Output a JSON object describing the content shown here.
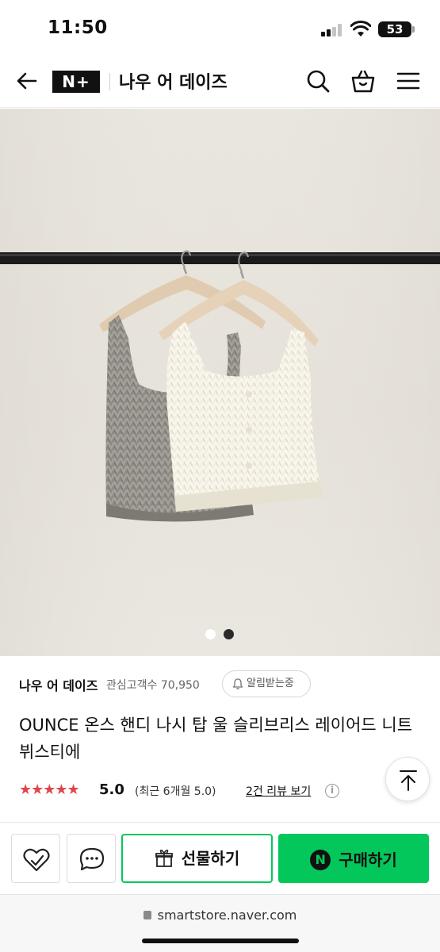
{
  "status_bar": {
    "time": "11:50",
    "battery": "53"
  },
  "header": {
    "brand_logo": "N+",
    "store_name": "나우 어 데이즈",
    "icons": [
      "back-arrow-icon",
      "search-icon",
      "shopping-bag-icon",
      "menu-icon"
    ]
  },
  "gallery": {
    "image_description_icon": "product-photo",
    "page_count": 2,
    "active_page": 2,
    "colors": {
      "background": "#e8e5de",
      "rod": "#1b1b1b",
      "gray_knit": "#8f8c86",
      "cream_knit": "#f3efe3",
      "hanger": "#e2cdb2"
    }
  },
  "store_info": {
    "name": "나우 어 데이즈",
    "favorites_label": "관심고객수 70,950",
    "alert_button": "알림받는중"
  },
  "product": {
    "title": "OUNCE 온스 핸디 나시 탑 울 슬리브리스 레이어드 니트 뷔스티에",
    "stars": "★★★★★",
    "rating": "5.0",
    "recent_rating": "(최근 6개월 5.0)",
    "review_link": "2건 리뷰 보기",
    "info_icon": "i"
  },
  "actions": {
    "gift_label": "선물하기",
    "buy_label": "구매하기",
    "buy_badge": "N",
    "colors": {
      "naver_green": "#03c75a"
    }
  },
  "browser": {
    "url": "smartstore.naver.com"
  }
}
